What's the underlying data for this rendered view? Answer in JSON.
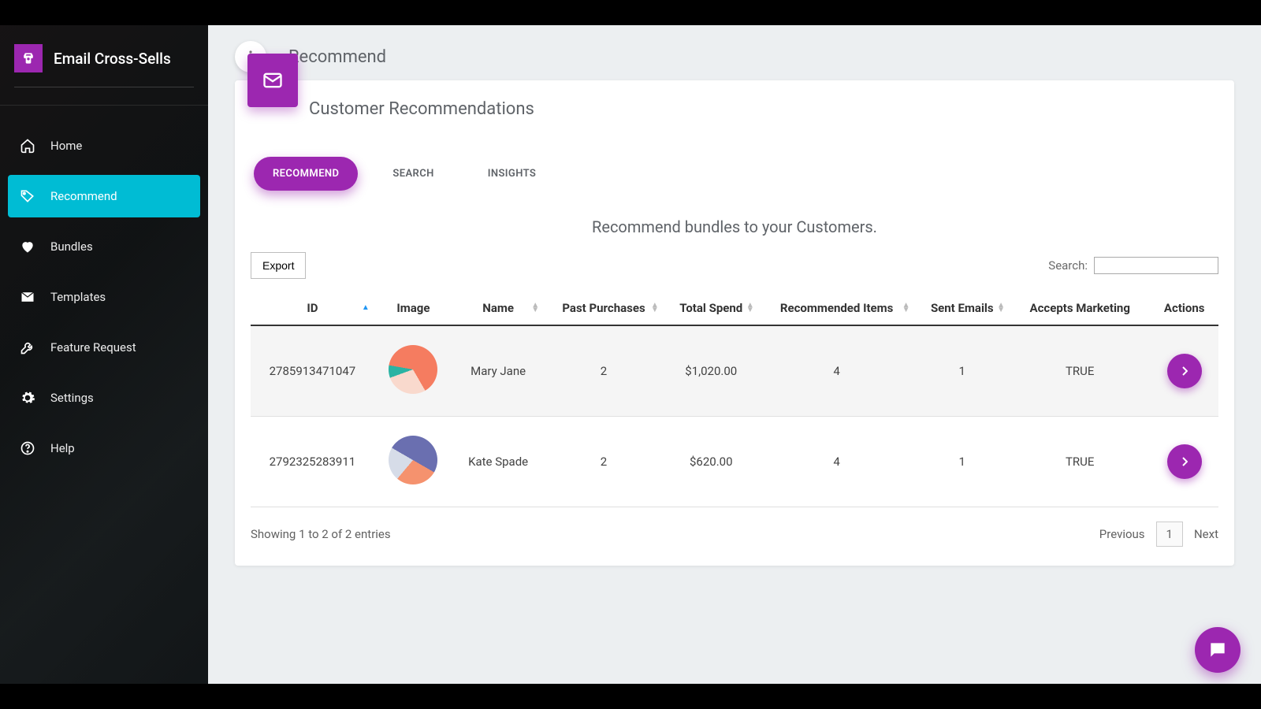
{
  "brand": {
    "title": "Email Cross-Sells"
  },
  "sidebar": {
    "items": [
      {
        "label": "Home"
      },
      {
        "label": "Recommend"
      },
      {
        "label": "Bundles"
      },
      {
        "label": "Templates"
      },
      {
        "label": "Feature Request"
      },
      {
        "label": "Settings"
      },
      {
        "label": "Help"
      }
    ]
  },
  "header": {
    "page_title": "Recommend"
  },
  "card": {
    "title": "Customer Recommendations",
    "tabs": [
      {
        "label": "RECOMMEND"
      },
      {
        "label": "SEARCH"
      },
      {
        "label": "INSIGHTS"
      }
    ],
    "subtitle": "Recommend bundles to your Customers.",
    "export_label": "Export",
    "search_label": "Search:"
  },
  "table": {
    "columns": [
      "ID",
      "Image",
      "Name",
      "Past Purchases",
      "Total Spend",
      "Recommended Items",
      "Sent Emails",
      "Accepts Marketing",
      "Actions"
    ],
    "rows": [
      {
        "id": "2785913471047",
        "name": "Mary Jane",
        "past": "2",
        "spend": "$1,020.00",
        "rec": "4",
        "sent": "1",
        "accepts": "TRUE"
      },
      {
        "id": "2792325283911",
        "name": "Kate Spade",
        "past": "2",
        "spend": "$620.00",
        "rec": "4",
        "sent": "1",
        "accepts": "TRUE"
      }
    ],
    "footer_info": "Showing 1 to 2 of 2 entries",
    "pager": {
      "prev": "Previous",
      "page": "1",
      "next": "Next"
    }
  }
}
